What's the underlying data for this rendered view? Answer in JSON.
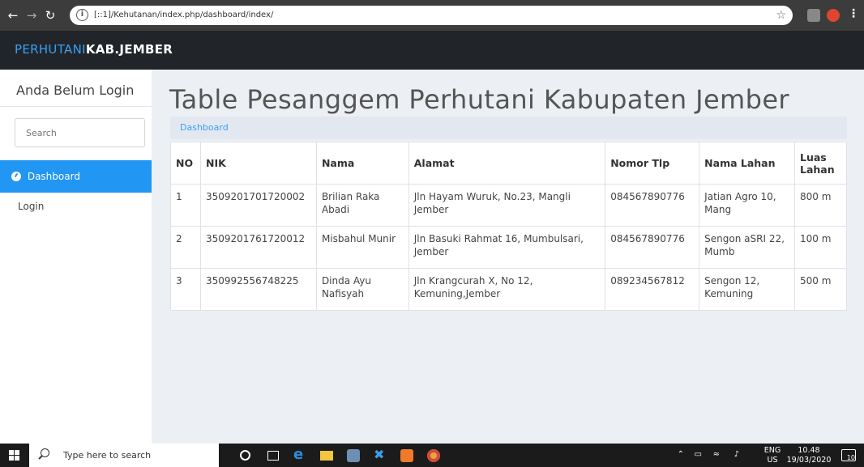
{
  "browser": {
    "url": "[::1]/Kehutanan/index.php/dashboard/index/"
  },
  "brand": {
    "part1": "PERHUTANI",
    "part2": "KAB.JEMBER",
    "color_part1": "#3a9ff5"
  },
  "sidebar": {
    "login_status": "Anda Belum Login",
    "search_placeholder": "Search",
    "items": [
      {
        "label": "Dashboard",
        "icon": "dashboard-icon",
        "active": true
      },
      {
        "label": "Login",
        "active": false
      }
    ],
    "accent_color": "#2196f3"
  },
  "main": {
    "title": "Table Pesanggem Perhutani Kabupaten Jember",
    "breadcrumb": "Dashboard",
    "table": {
      "headers": [
        "NO",
        "NIK",
        "Nama",
        "Alamat",
        "Nomor Tlp",
        "Nama Lahan",
        "Luas Lahan"
      ],
      "rows": [
        [
          "1",
          "3509201701720002",
          "Brilian Raka Abadi",
          "Jln Hayam Wuruk, No.23, Mangli Jember",
          "084567890776",
          "Jatian Agro 10, Mang",
          "800 m"
        ],
        [
          "2",
          "3509201761720012",
          "Misbahul Munir",
          "Jln Basuki Rahmat 16, Mumbulsari, Jember",
          "084567890776",
          "Sengon aSRI 22, Mumb",
          "100 m"
        ],
        [
          "3",
          "350992556748225",
          "Dinda Ayu Nafisyah",
          "Jln Krangcurah X, No 12, Kemuning,Jember",
          "089234567812",
          "Sengon 12, Kemuning",
          "500 m"
        ]
      ]
    }
  },
  "taskbar": {
    "search_placeholder": "Type here to search",
    "lang_top": "ENG",
    "lang_bottom": "US",
    "time": "10.48",
    "date": "19/03/2020",
    "notification_count": "10"
  }
}
